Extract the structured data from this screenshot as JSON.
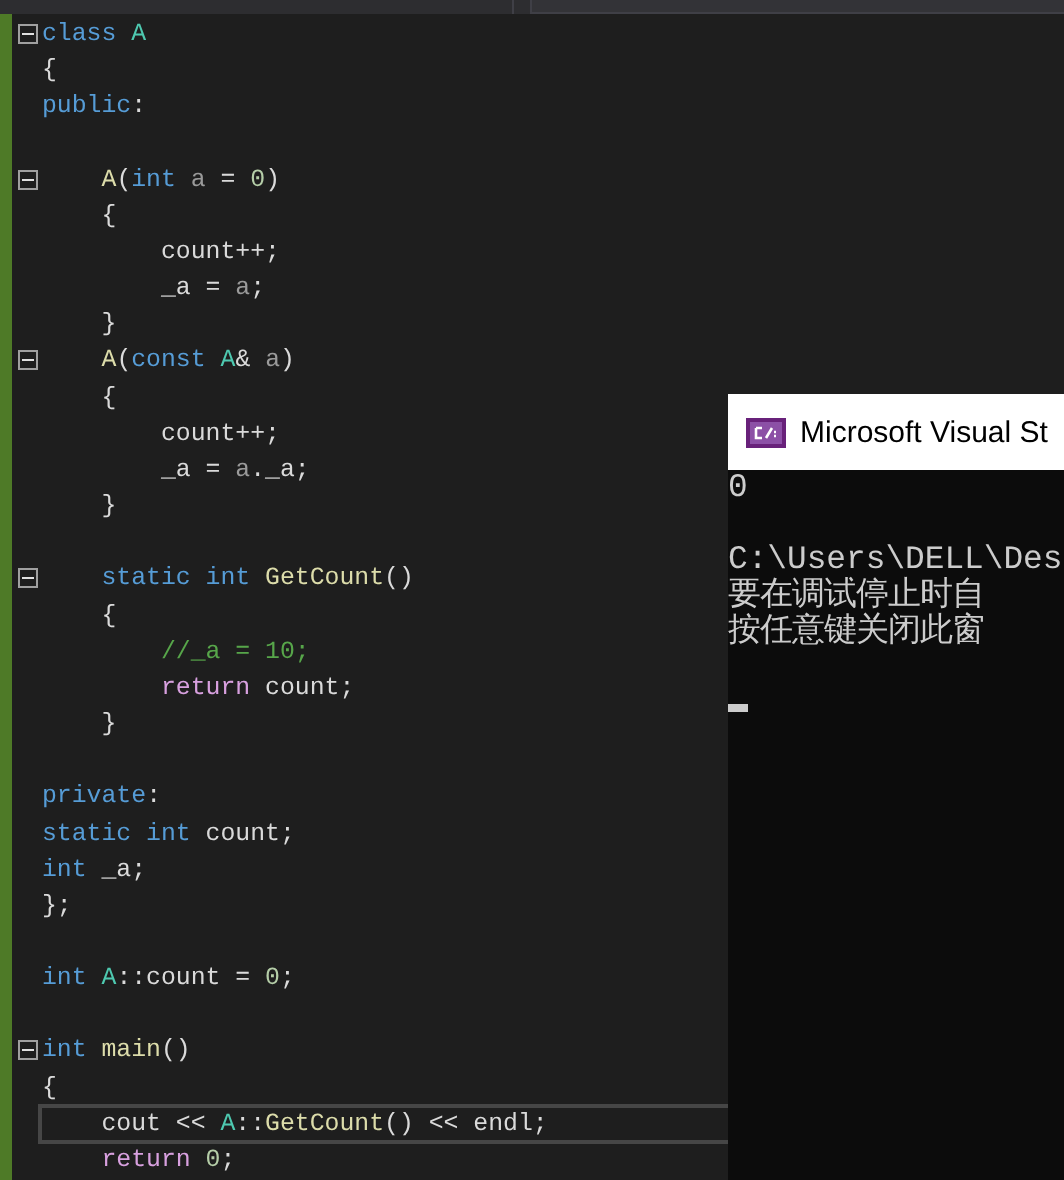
{
  "editor": {
    "lines": [
      {
        "tokens": [
          {
            "kind": "keyword",
            "text": "class "
          },
          {
            "kind": "type",
            "text": "A"
          }
        ],
        "expanded": true
      },
      {
        "tokens": [
          {
            "kind": "plain",
            "text": "{"
          }
        ]
      },
      {
        "tokens": [
          {
            "kind": "keyword",
            "text": "public"
          },
          {
            "kind": "plain",
            "text": ":"
          }
        ]
      },
      {
        "kind": "blank"
      },
      {
        "tokens": [
          {
            "kind": "function",
            "text": "    A"
          },
          {
            "kind": "plain",
            "text": "("
          },
          {
            "kind": "keyword",
            "text": "int "
          },
          {
            "kind": "param",
            "text": "a"
          },
          {
            "kind": "plain",
            "text": " = "
          },
          {
            "kind": "number",
            "text": "0"
          },
          {
            "kind": "plain",
            "text": ")"
          }
        ],
        "expanded": true
      },
      {
        "tokens": [
          {
            "kind": "plain",
            "text": "    {"
          }
        ]
      },
      {
        "tokens": [
          {
            "kind": "plain",
            "text": "        count++;"
          }
        ]
      },
      {
        "tokens": [
          {
            "kind": "plain",
            "text": "        _a = "
          },
          {
            "kind": "param",
            "text": "a"
          },
          {
            "kind": "plain",
            "text": ";"
          }
        ]
      },
      {
        "tokens": [
          {
            "kind": "plain",
            "text": "    }"
          }
        ]
      },
      {
        "tokens": [
          {
            "kind": "function",
            "text": "    A"
          },
          {
            "kind": "plain",
            "text": "("
          },
          {
            "kind": "keyword",
            "text": "const "
          },
          {
            "kind": "type",
            "text": "A"
          },
          {
            "kind": "plain",
            "text": "& "
          },
          {
            "kind": "param",
            "text": "a"
          },
          {
            "kind": "plain",
            "text": ")"
          }
        ],
        "expanded": true
      },
      {
        "tokens": [
          {
            "kind": "plain",
            "text": "    {"
          }
        ]
      },
      {
        "tokens": [
          {
            "kind": "plain",
            "text": "        count++;"
          }
        ]
      },
      {
        "tokens": [
          {
            "kind": "plain",
            "text": "        _a = "
          },
          {
            "kind": "param",
            "text": "a"
          },
          {
            "kind": "plain",
            "text": "._a;"
          }
        ]
      },
      {
        "tokens": [
          {
            "kind": "plain",
            "text": "    }"
          }
        ]
      },
      {
        "kind": "blank"
      },
      {
        "tokens": [
          {
            "kind": "keyword",
            "text": "    static int "
          },
          {
            "kind": "function",
            "text": "GetCount"
          },
          {
            "kind": "plain",
            "text": "()"
          }
        ],
        "expanded": true
      },
      {
        "tokens": [
          {
            "kind": "plain",
            "text": "    {"
          }
        ]
      },
      {
        "tokens": [
          {
            "kind": "comment",
            "text": "        //_a = 10;"
          }
        ]
      },
      {
        "tokens": [
          {
            "kind": "control",
            "text": "        return "
          },
          {
            "kind": "plain",
            "text": "count;"
          }
        ]
      },
      {
        "tokens": [
          {
            "kind": "plain",
            "text": "    }"
          }
        ]
      },
      {
        "kind": "blank"
      },
      {
        "tokens": [
          {
            "kind": "keyword",
            "text": "private"
          },
          {
            "kind": "plain",
            "text": ":"
          }
        ]
      },
      {
        "tokens": [
          {
            "kind": "keyword",
            "text": "static int "
          },
          {
            "kind": "plain",
            "text": "count;"
          }
        ]
      },
      {
        "tokens": [
          {
            "kind": "keyword",
            "text": "int "
          },
          {
            "kind": "plain",
            "text": "_a;"
          }
        ]
      },
      {
        "tokens": [
          {
            "kind": "plain",
            "text": "};"
          }
        ]
      },
      {
        "kind": "blank"
      },
      {
        "tokens": [
          {
            "kind": "keyword",
            "text": "int "
          },
          {
            "kind": "type",
            "text": "A"
          },
          {
            "kind": "plain",
            "text": "::count = "
          },
          {
            "kind": "number",
            "text": "0"
          },
          {
            "kind": "plain",
            "text": ";"
          }
        ]
      },
      {
        "kind": "blank"
      },
      {
        "tokens": [
          {
            "kind": "keyword",
            "text": "int "
          },
          {
            "kind": "function",
            "text": "main"
          },
          {
            "kind": "plain",
            "text": "()"
          }
        ],
        "expanded": true
      },
      {
        "tokens": [
          {
            "kind": "plain",
            "text": "{"
          }
        ]
      },
      {
        "tokens": [
          {
            "kind": "plain",
            "text": "    cout << "
          },
          {
            "kind": "type",
            "text": "A"
          },
          {
            "kind": "plain",
            "text": "::"
          },
          {
            "kind": "function",
            "text": "GetCount"
          },
          {
            "kind": "plain",
            "text": "() << endl;"
          }
        ],
        "selected": true
      },
      {
        "tokens": [
          {
            "kind": "control",
            "text": "    return "
          },
          {
            "kind": "number",
            "text": "0"
          },
          {
            "kind": "plain",
            "text": ";"
          }
        ]
      }
    ]
  },
  "console": {
    "title": "Microsoft Visual St",
    "lines": [
      {
        "kind": "text",
        "text": "0"
      },
      {
        "kind": "blank"
      },
      {
        "kind": "text",
        "text": "C:\\Users\\DELL\\Des"
      },
      {
        "kind": "text",
        "text": "要在调试停止时自"
      },
      {
        "kind": "text",
        "text": "按任意键关闭此窗"
      },
      {
        "kind": "blank"
      },
      {
        "kind": "cursor"
      }
    ]
  }
}
